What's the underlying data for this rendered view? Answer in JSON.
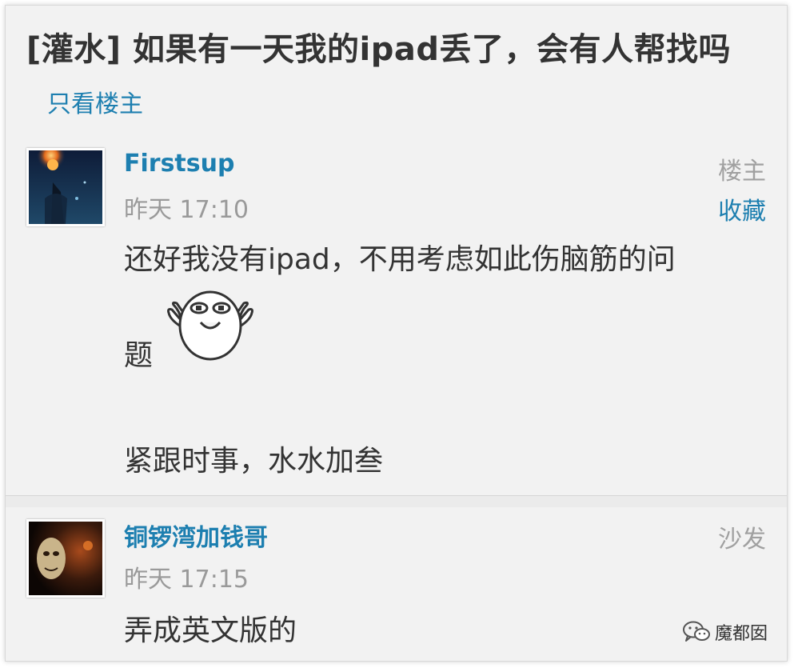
{
  "thread": {
    "title": "[灌水] 如果有一天我的ipad丢了，会有人帮找吗",
    "only_op_label": "只看楼主"
  },
  "posts": [
    {
      "username": "Firstsup",
      "time": "昨天 17:10",
      "floor": "楼主",
      "action": "收藏",
      "lines": [
        "还好我没有ipad，不用考虑如此伤脑筋的问",
        "题",
        "紧跟时事，水水加叁"
      ],
      "avatar_icon": "fiery-planet-avatar",
      "emoji_icon": "waving-face-emoji"
    },
    {
      "username": "铜锣湾加钱哥",
      "time": "昨天 17:15",
      "floor": "沙发",
      "lines": [
        "弄成英文版的"
      ],
      "avatar_icon": "masked-face-avatar"
    }
  ],
  "watermark": {
    "text": "魔都囡",
    "icon": "wechat-icon"
  },
  "colors": {
    "accent": "#1d7fb0",
    "text": "#333333",
    "muted": "#9a9a9a",
    "background": "#f2f2f2"
  }
}
